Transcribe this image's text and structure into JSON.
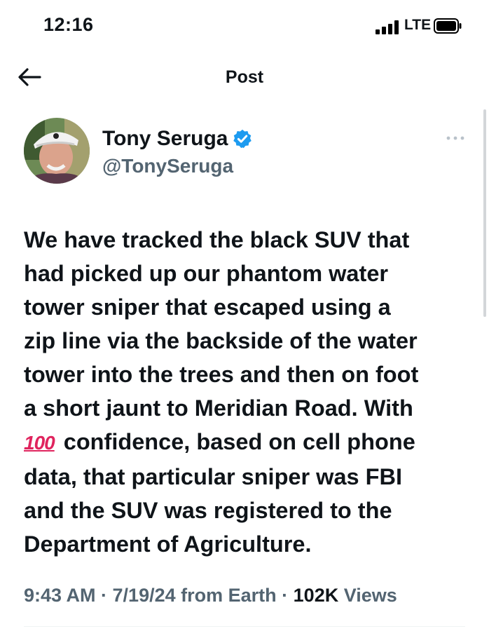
{
  "status_bar": {
    "time": "12:16",
    "network": "LTE",
    "signal_icon": "cellular-signal-icon",
    "battery_icon": "battery-icon"
  },
  "nav": {
    "title": "Post",
    "back_icon": "back-arrow-icon"
  },
  "author": {
    "name": "Tony Seruga",
    "handle": "@TonySeruga",
    "verified": true,
    "verified_color": "#1d9bf0"
  },
  "post": {
    "lines": [
      "We have tracked the black SUV that",
      "had picked up our phantom water",
      "tower sniper that escaped using a",
      "zip line via the backside of the water",
      "tower into the trees and then on foot",
      "a short jaunt to Meridian Road. With",
      " confidence, based on cell phone",
      "data, that particular sniper was FBI",
      "and the SUV was registered to the",
      "Department of Agriculture."
    ],
    "emoji": "100",
    "emoji_icon": "hundred-points-emoji-icon"
  },
  "meta": {
    "time": "9:43 AM",
    "sep1": " · ",
    "date": "7/19/24",
    "source": " from Earth",
    "sep2": " · ",
    "views_count": "102K",
    "views_label": " Views"
  },
  "colors": {
    "text": "#0f1419",
    "secondary": "#536471",
    "accent": "#1d9bf0",
    "emoji_red": "#e0245e"
  }
}
